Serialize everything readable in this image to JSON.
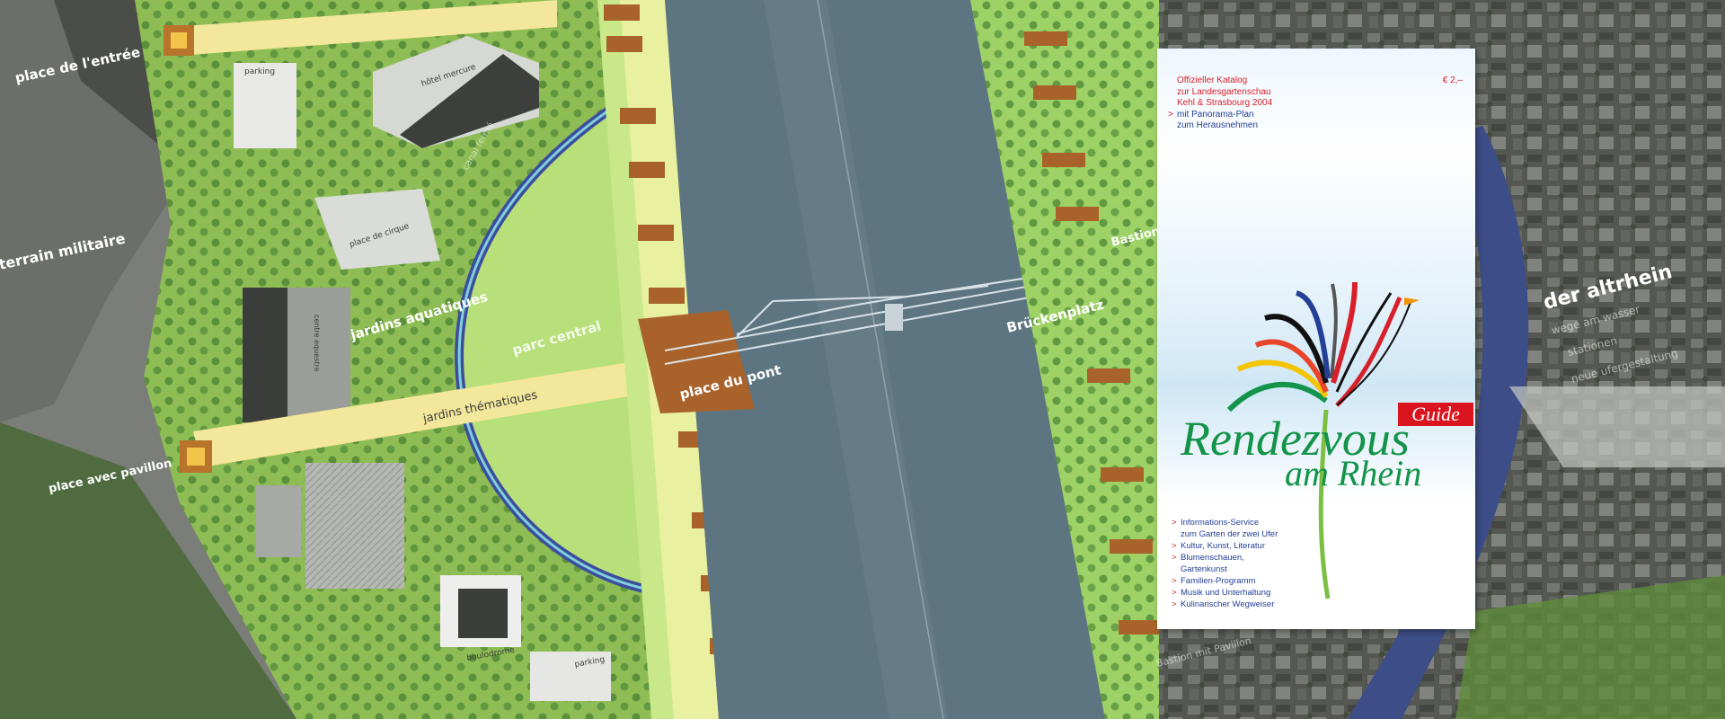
{
  "map": {
    "labels": {
      "place_entree": "place de l'entrée",
      "terrain_militaire": "terrain militaire",
      "place_pavillon": "place avec pavillon",
      "jardins_aquatiques": "jardins aquatiques",
      "parc_central": "parc central",
      "jardins_thematiques": "jardins thématiques",
      "place_du_pont": "place du pont",
      "bruckenplatz": "Brückenplatz",
      "bastion": "Bastion",
      "der_altrhein": "der altrhein",
      "altrhein_sub1": "wege am wasser",
      "altrhein_sub2": "stationen",
      "altrhein_sub3": "neue ufergestaltung",
      "bastion_pavillon": "Bastion mit Pavillon",
      "parking1": "parking",
      "parking2": "parking",
      "hotel": "hôtel mercure",
      "place_cirque": "place de cirque",
      "centre_equestre": "centre equestre",
      "boulodrome": "boulodrome",
      "canal": "canal fermé"
    }
  },
  "brochure": {
    "header": {
      "line1": "Offizieller Katalog",
      "line2": "zur Landesgartenschau",
      "line3": "Kehl & Strasbourg 2004",
      "line4": "mit Panorama-Plan",
      "line5": "zum Herausnehmen",
      "prefix": ">"
    },
    "price": "€ 2,–",
    "badge": "Guide",
    "title_line1": "Rendezvous",
    "title_line2": "am Rhein",
    "list_prefix": ">",
    "list": [
      "Informations-Service",
      "zum Garten der zwei Ufer",
      "Kultur, Kunst, Literatur",
      "Blumenschauen,",
      "Gartenkunst",
      "Familien-Programm",
      "Musik und Unterhaltung",
      "Kulinarischer Wegweiser"
    ],
    "colors": {
      "green": "#13944a",
      "red": "#d8202a",
      "blue": "#233f96"
    }
  }
}
